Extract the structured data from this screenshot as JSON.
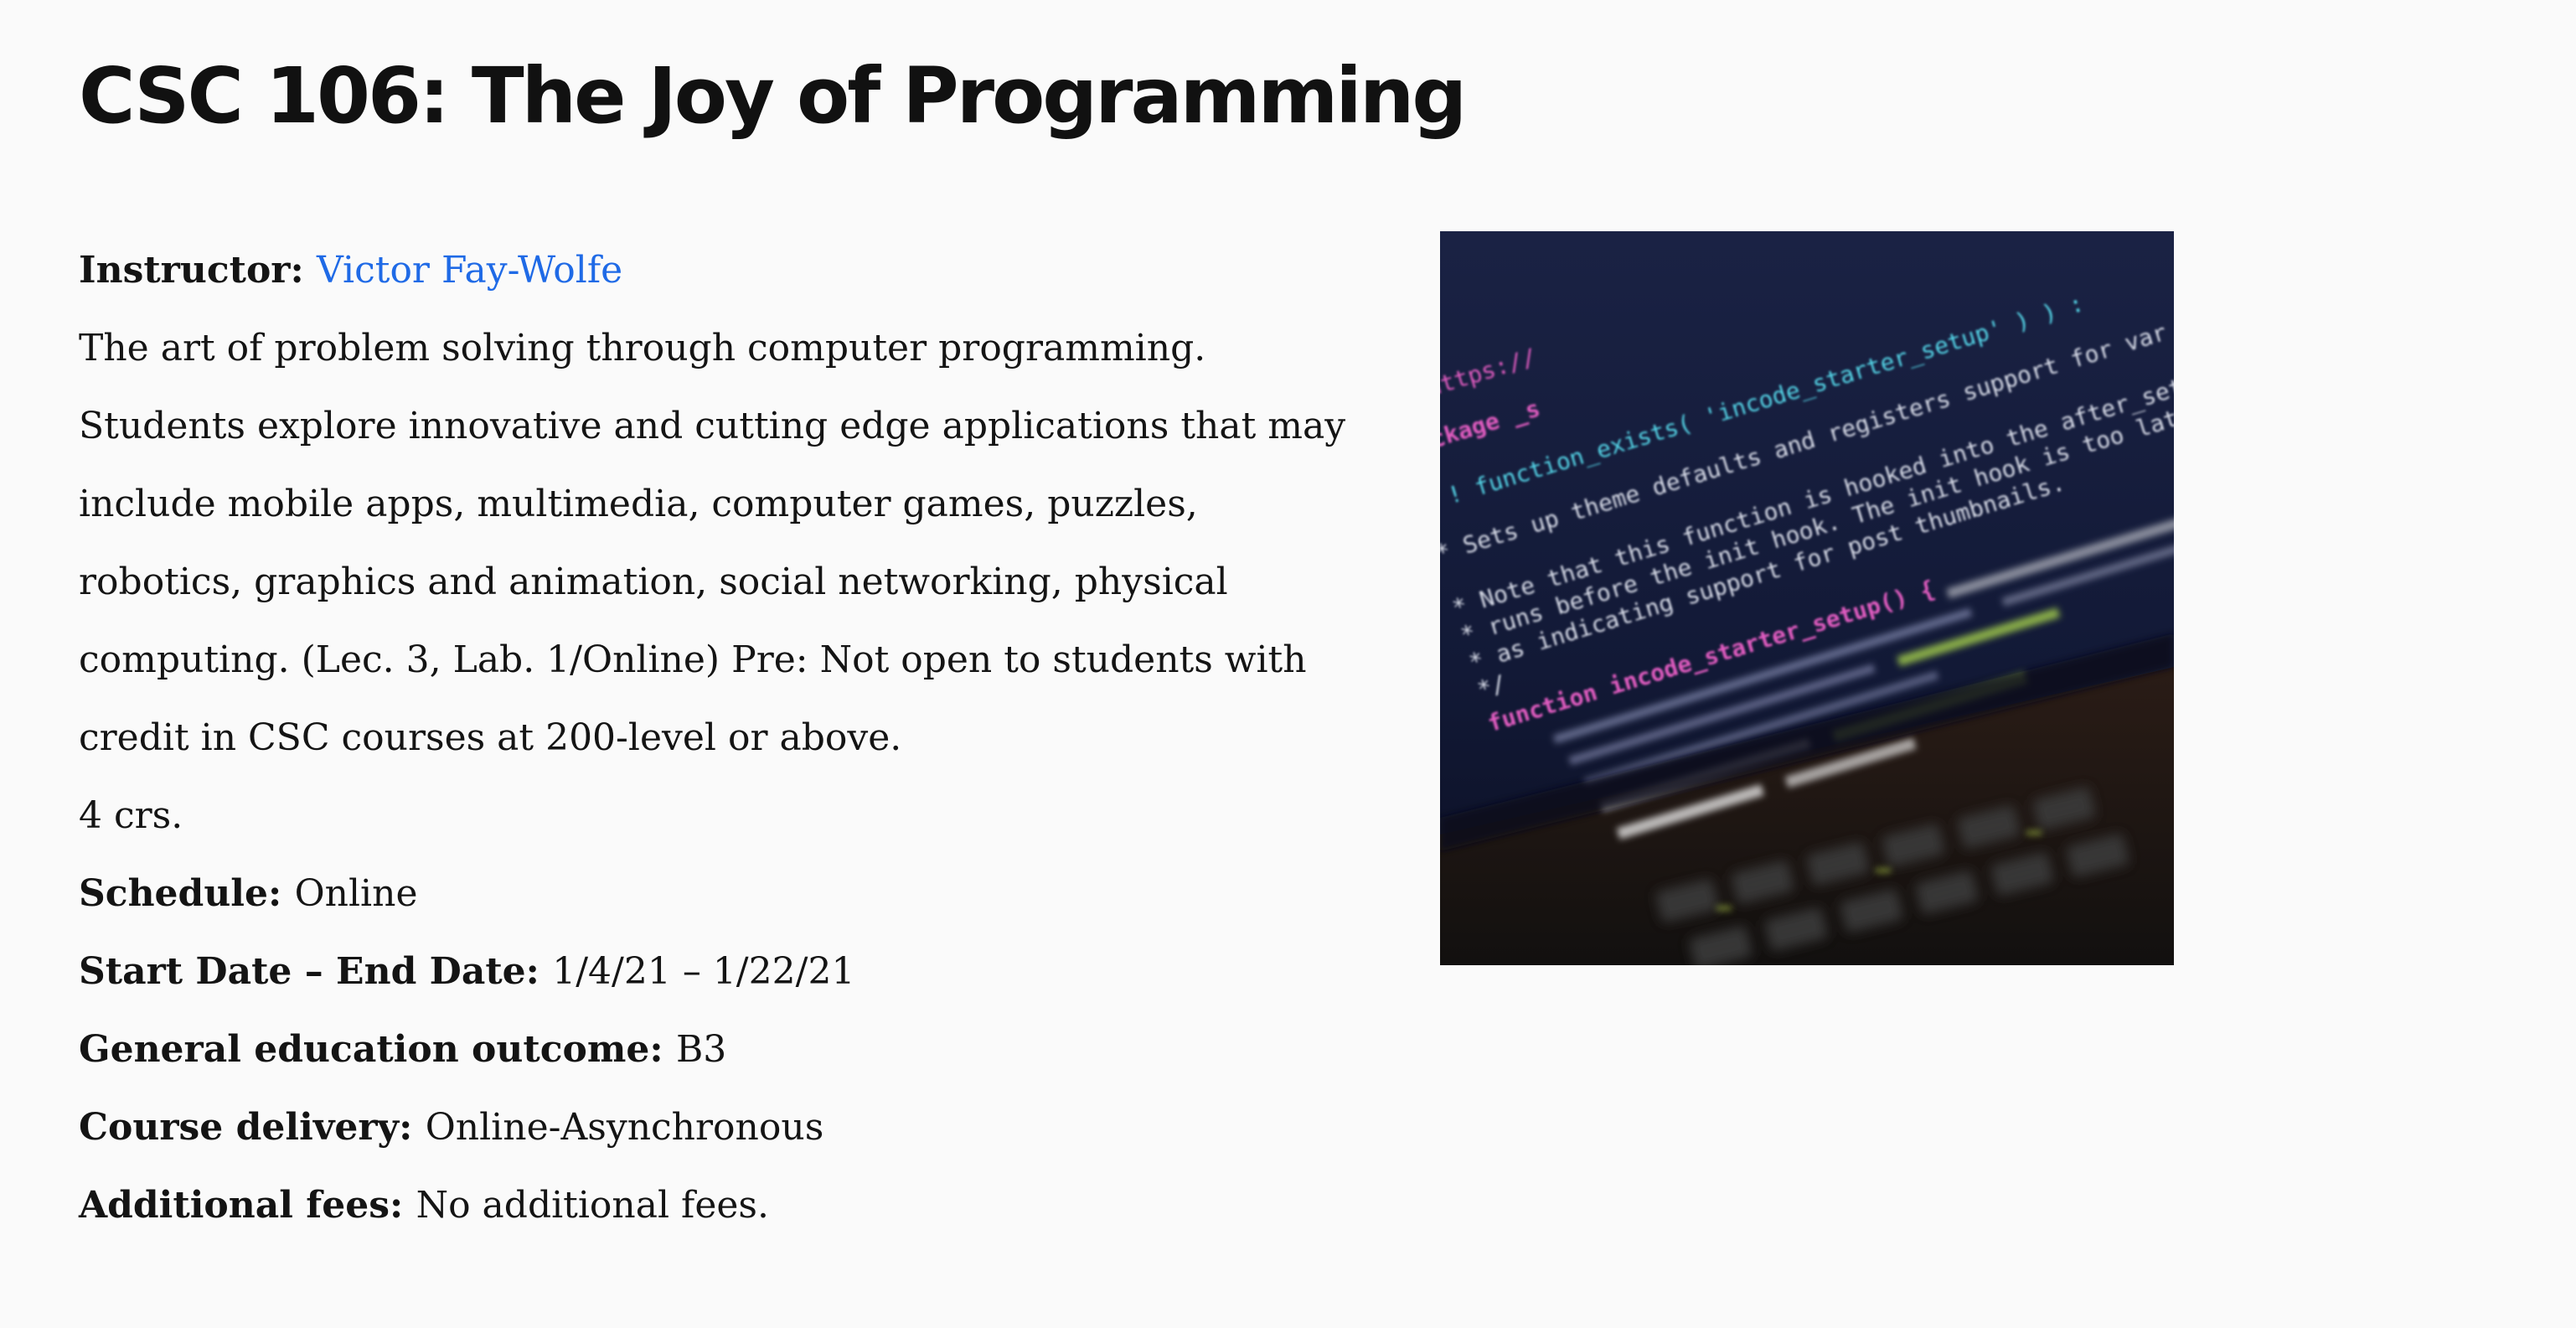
{
  "course": {
    "title": "CSC 106: The Joy of Programming"
  },
  "instructor": {
    "label": "Instructor:",
    "name": "Victor Fay-Wolfe"
  },
  "description": {
    "lines": [
      "The art of problem solving through computer programming.",
      "Students explore innovative and cutting edge applications that may",
      "include mobile apps, multimedia, computer games, puzzles,",
      "robotics, graphics and animation, social networking, physical",
      "computing. (Lec. 3, Lab. 1/Online) Pre: Not open to students with",
      "credit in CSC courses at 200-level or above."
    ],
    "credits": "4 crs."
  },
  "details": {
    "schedule_label": "Schedule:",
    "schedule_value": "Online",
    "dates_label": "Start Date – End Date:",
    "dates_value": "1/4/21 – 1/22/21",
    "gened_label": "General education outcome:",
    "gened_value": "B3",
    "delivery_label": "Course delivery:",
    "delivery_value": "Online-Asynchronous",
    "fees_label": "Additional fees:",
    "fees_value": "No additional fees."
  },
  "image": {
    "code_lines": [
      "ink https://",
      "package _s",
      "( ! function_exists( 'incode_starter_setup' ) ) :",
      "* Sets up theme defaults and registers support for var",
      "* Note that this function is hooked into the after_setu",
      "* runs before the init hook. The init hook is too late",
      "* as indicating support for post thumbnails.",
      "*/",
      "function incode_starter_setup() {"
    ]
  },
  "colors": {
    "link": "#1f6ae6",
    "text": "#141414",
    "background": "#fafafa"
  }
}
